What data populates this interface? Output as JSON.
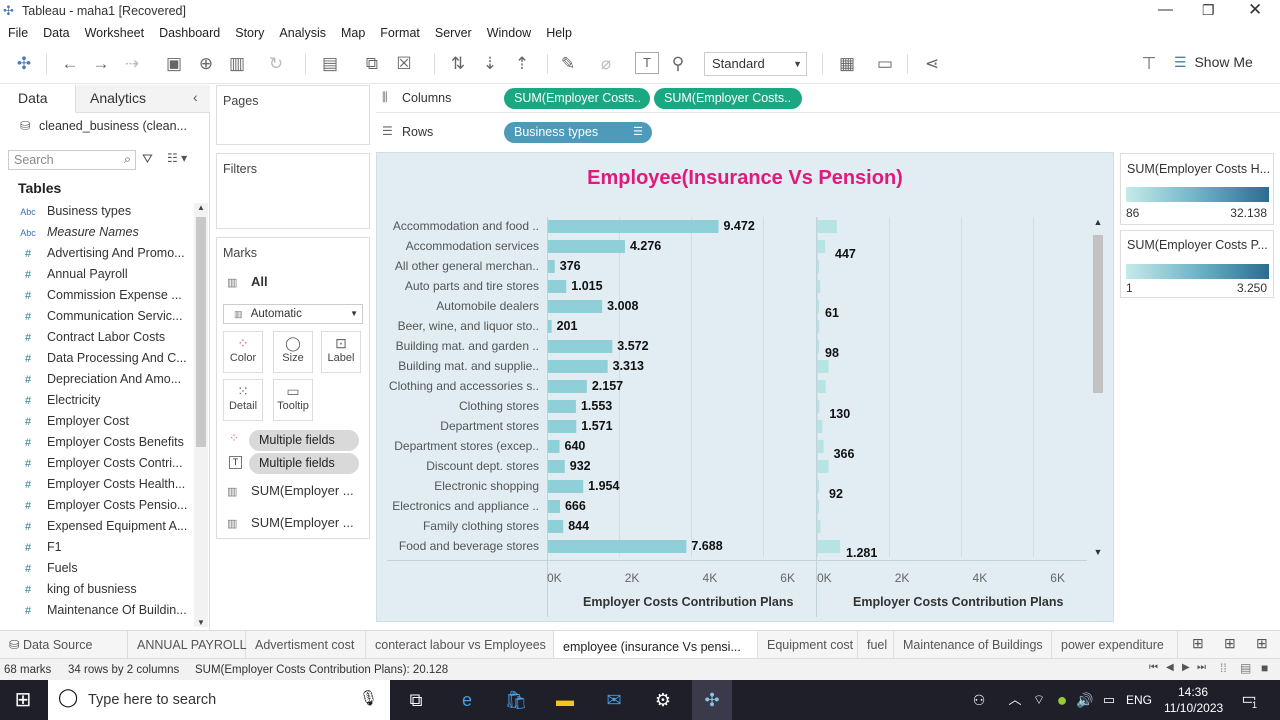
{
  "window": {
    "title": "Tableau - maha1 [Recovered]"
  },
  "menu": [
    "File",
    "Data",
    "Worksheet",
    "Dashboard",
    "Story",
    "Analysis",
    "Map",
    "Format",
    "Server",
    "Window",
    "Help"
  ],
  "toolbar": {
    "fit_mode": "Standard",
    "show_me": "Show Me"
  },
  "data_pane": {
    "tab_data": "Data",
    "tab_analytics": "Analytics",
    "datasource": "cleaned_business (clean...",
    "search_placeholder": "Search",
    "tables_label": "Tables",
    "fields": [
      {
        "type": "Abc",
        "name": "Business types"
      },
      {
        "type": "Abc",
        "name": "Measure Names"
      },
      {
        "type": "#",
        "name": "Advertising And Promo..."
      },
      {
        "type": "#",
        "name": "Annual Payroll"
      },
      {
        "type": "#",
        "name": "Commission Expense ..."
      },
      {
        "type": "#",
        "name": "Communication Servic..."
      },
      {
        "type": "#",
        "name": "Contract Labor Costs"
      },
      {
        "type": "#",
        "name": "Data Processing And C..."
      },
      {
        "type": "#",
        "name": "Depreciation And Amo..."
      },
      {
        "type": "#",
        "name": "Electricity"
      },
      {
        "type": "#",
        "name": "Employer Cost"
      },
      {
        "type": "#",
        "name": "Employer Costs Benefits"
      },
      {
        "type": "#",
        "name": "Employer Costs Contri..."
      },
      {
        "type": "#",
        "name": "Employer Costs Health..."
      },
      {
        "type": "#",
        "name": "Employer Costs Pensio..."
      },
      {
        "type": "#",
        "name": "Expensed Equipment A..."
      },
      {
        "type": "#",
        "name": "F1"
      },
      {
        "type": "#",
        "name": "Fuels"
      },
      {
        "type": "#",
        "name": "king of busniess"
      },
      {
        "type": "#",
        "name": "Maintenance Of Buildin..."
      }
    ]
  },
  "shelves": {
    "pages": "Pages",
    "filters": "Filters",
    "columns_label": "Columns",
    "rows_label": "Rows",
    "columns_pills": [
      "SUM(Employer Costs..",
      "SUM(Employer Costs.."
    ],
    "rows_pill": "Business types"
  },
  "marks": {
    "title": "Marks",
    "all": "All",
    "type": "Automatic",
    "buttons": [
      "Color",
      "Size",
      "Label",
      "Detail",
      "Tooltip"
    ],
    "multiple_fields": [
      "Multiple fields",
      "Multiple fields"
    ],
    "sheets": [
      "SUM(Employer ...",
      "SUM(Employer ..."
    ]
  },
  "chart_data": {
    "type": "bar",
    "title": "Employee(Insurance Vs Pension)",
    "categories": [
      "Accommodation and food ..",
      "Accommodation services",
      "All other general merchan..",
      "Auto parts and tire stores",
      "Automobile dealers",
      "Beer, wine, and liquor sto..",
      "Building mat. and garden ..",
      "Building mat. and supplie..",
      "Clothing and accessories s..",
      "Clothing stores",
      "Department stores",
      "Department stores (excep..",
      "Discount dept. stores",
      "Electronic shopping",
      "Electronics and appliance ..",
      "Family clothing stores",
      "Food and beverage stores"
    ],
    "series": [
      {
        "values": [
          9472,
          4276,
          376,
          1015,
          3008,
          201,
          3572,
          3313,
          2157,
          1553,
          1571,
          640,
          932,
          1954,
          666,
          844,
          7688
        ],
        "labels": [
          "9.472",
          "4.276",
          "376",
          "1.015",
          "3.008",
          "201",
          "3.572",
          "3.313",
          "2.157",
          "1.553",
          "1.571",
          "640",
          "932",
          "1.954",
          "666",
          "844",
          "7.688"
        ]
      },
      {
        "values": [
          1100,
          447,
          40,
          180,
          61,
          120,
          98,
          640,
          480,
          130,
          300,
          366,
          640,
          92,
          90,
          190,
          1281
        ],
        "labels": [
          "",
          "447",
          "",
          "",
          "61",
          "",
          "98",
          "",
          "",
          "130",
          "",
          "366",
          "",
          "92",
          "",
          "",
          "1.281"
        ]
      }
    ],
    "xlabels": [
      "Employer Costs Contribution Plans",
      "Employer Costs Contribution Plans"
    ],
    "xticks": [
      "0K",
      "2K",
      "4K",
      "6K"
    ],
    "xlim": [
      0,
      7500
    ]
  },
  "legends": [
    {
      "title": "SUM(Employer Costs H...",
      "min": "86",
      "max": "32.138"
    },
    {
      "title": "SUM(Employer Costs P...",
      "min": "1",
      "max": "3.250"
    }
  ],
  "sheet_tabs": [
    "Data Source",
    "ANNUAL PAYROLL",
    "Advertisment cost",
    "conteract labour vs Employees",
    "employee (insurance Vs pensi...",
    "Equipment cost",
    "fuel",
    "Maintenance of Buildings",
    "power expenditure"
  ],
  "status": {
    "marks": "68 marks",
    "dims": "34 rows by 2 columns",
    "sum": "SUM(Employer Costs Contribution Plans): 20.128"
  },
  "taskbar": {
    "search_placeholder": "Type here to search",
    "lang": "ENG",
    "time": "14:36",
    "date": "11/10/2023",
    "notif_count": "1"
  }
}
